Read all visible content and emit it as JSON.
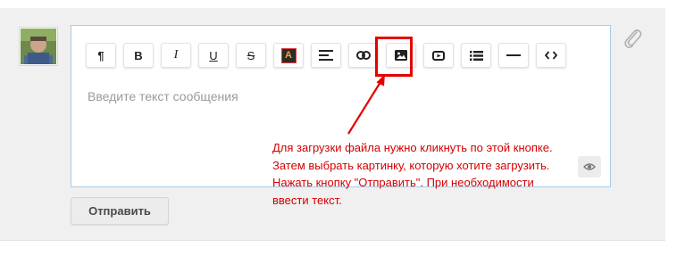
{
  "toolbar": {
    "buttons": [
      {
        "name": "paragraph",
        "label": "¶",
        "icon": "paragraph-icon"
      },
      {
        "name": "bold",
        "label": "B",
        "icon": "bold-icon"
      },
      {
        "name": "italic",
        "label": "I",
        "icon": "italic-icon"
      },
      {
        "name": "underline",
        "label": "U",
        "icon": "underline-icon"
      },
      {
        "name": "strikethrough",
        "label": "S",
        "icon": "strikethrough-icon"
      },
      {
        "name": "text-color",
        "label": "A",
        "icon": "text-color-icon"
      },
      {
        "name": "align",
        "icon": "align-left-icon"
      },
      {
        "name": "link",
        "icon": "link-icon"
      },
      {
        "name": "image",
        "icon": "image-icon"
      },
      {
        "name": "video",
        "icon": "video-icon"
      },
      {
        "name": "list",
        "icon": "list-icon"
      },
      {
        "name": "hr",
        "icon": "horizontal-rule-icon"
      },
      {
        "name": "code",
        "icon": "code-icon"
      }
    ]
  },
  "editor": {
    "placeholder": "Введите текст сообщения",
    "preview_icon": "eye-icon"
  },
  "attach_icon": "paperclip-icon",
  "send_button": {
    "label": "Отправить"
  },
  "annotation": {
    "color": "#d40000",
    "lines": [
      "Для загрузки файла нужно кликнуть по этой кнопке.",
      "Затем выбрать картинку, которую хотите загрузить.",
      "Нажать кнопку \"Отправить\". При необходимости",
      "ввести текст."
    ]
  },
  "colors": {
    "editor_border": "#a9cce6",
    "panel_bg": "#f0f0f0",
    "highlight": "#e60000"
  }
}
